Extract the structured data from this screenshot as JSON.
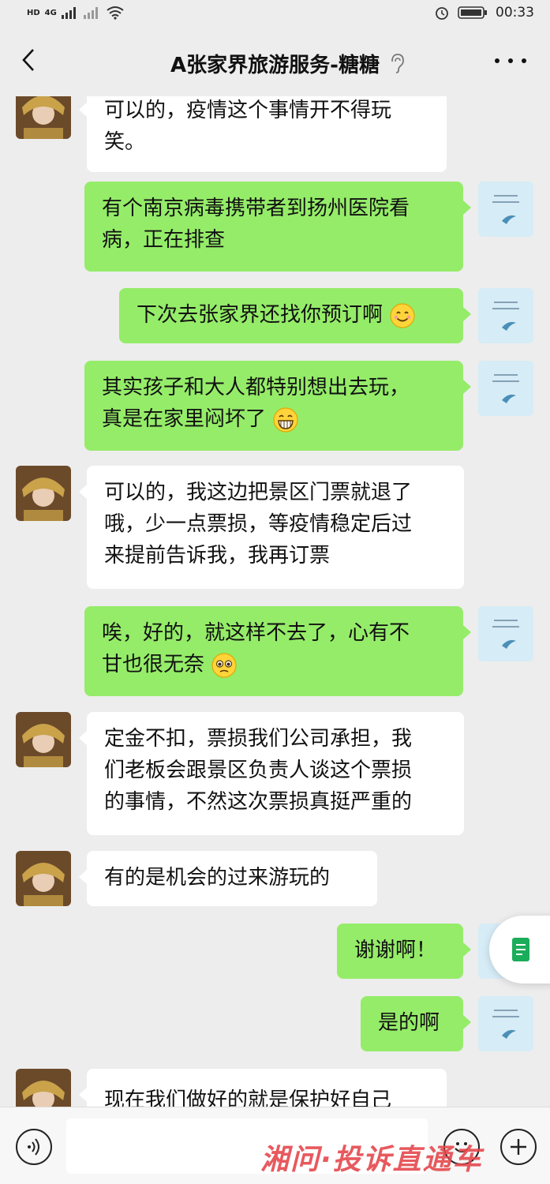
{
  "status_bar": {
    "network_badge": "HD",
    "signal_label": "4G",
    "time": "00:33"
  },
  "header": {
    "title": "A张家界旅游服务-糖糖"
  },
  "messages": [
    {
      "side": "in",
      "lines": [
        "可以的，疫情这个事情开不得玩",
        "笑。"
      ]
    },
    {
      "side": "out",
      "lines": [
        "有个南京病毒携带者到扬州医院看",
        "病，正在排查"
      ]
    },
    {
      "side": "out",
      "lines": [
        "下次去张家界还找你预订啊"
      ],
      "emoji": "smile-emoji"
    },
    {
      "side": "out",
      "lines": [
        "其实孩子和大人都特别想出去玩，",
        "真是在家里闷坏了"
      ],
      "emoji": "grin-emoji"
    },
    {
      "side": "in",
      "lines": [
        "可以的，我这边把景区门票就退了",
        "哦，少一点票损，等疫情稳定后过",
        "来提前告诉我，我再订票"
      ]
    },
    {
      "side": "out",
      "lines": [
        "唉，好的，就这样不去了，心有不",
        "甘也很无奈"
      ],
      "emoji": "pleading-emoji"
    },
    {
      "side": "in",
      "lines": [
        "定金不扣，票损我们公司承担，我",
        "们老板会跟景区负责人谈这个票损",
        "的事情，不然这次票损真挺严重的"
      ]
    },
    {
      "side": "in",
      "lines": [
        "有的是机会的过来游玩的"
      ]
    },
    {
      "side": "out",
      "lines": [
        "谢谢啊！"
      ]
    },
    {
      "side": "out",
      "lines": [
        "是的啊"
      ]
    },
    {
      "side": "in",
      "lines": [
        "现在我们做好的就是保护好自己"
      ]
    }
  ],
  "watermark": "湘问·投诉直通车",
  "colors": {
    "outgoing_bubble": "#95ec69",
    "incoming_bubble": "#ffffff",
    "background": "#ededed",
    "watermark": "#e5484d"
  }
}
